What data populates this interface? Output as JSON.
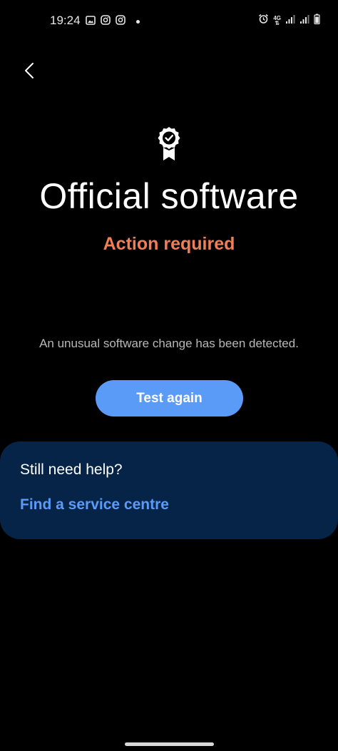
{
  "status_bar": {
    "time": "19:24",
    "left_icons": [
      "image-icon",
      "instagram-icon",
      "instagram-icon",
      "dot-icon"
    ],
    "right_icons": [
      "alarm-icon",
      "4g-icon",
      "signal-icon",
      "signal-icon",
      "battery-icon"
    ],
    "network_label": "4G"
  },
  "header": {
    "back_icon": "chevron-left-icon"
  },
  "main": {
    "badge_icon": "verified-badge-icon",
    "title": "Official software",
    "status": "Action required",
    "message": "An unusual software change has been detected.",
    "test_again_label": "Test again"
  },
  "help": {
    "title": "Still need help?",
    "link_label": "Find a service centre"
  },
  "colors": {
    "background": "#000000",
    "accent_orange": "#f07f58",
    "accent_blue": "#5b9bf8",
    "card_background": "#062447"
  }
}
